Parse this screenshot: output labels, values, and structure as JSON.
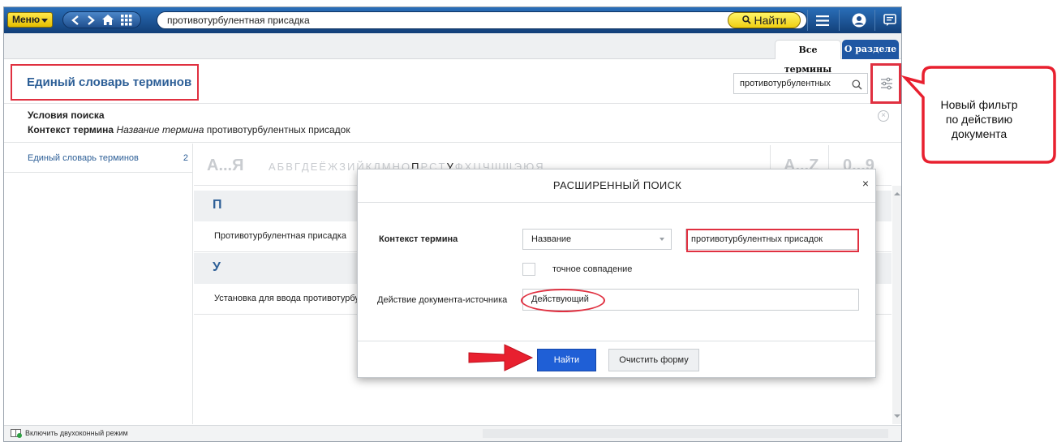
{
  "topbar": {
    "menu_label": "Меню",
    "search_value": "противотурбулентная присадка",
    "find_label": "Найти"
  },
  "tabs": [
    {
      "label": "Все термины",
      "active": true
    },
    {
      "label": "О разделе",
      "active": false
    }
  ],
  "header": {
    "title": "Единый словарь терминов",
    "search_value": "противотурбулентных"
  },
  "conditions": {
    "title": "Условия поиска",
    "field_label": "Контекст термина",
    "field_mode": "Название термина",
    "field_value": "противотурбулентных присадок"
  },
  "sidebar": {
    "items": [
      {
        "label": "Единый словарь терминов",
        "count": "2"
      }
    ]
  },
  "alphabet": {
    "cyrillic_range": "А...Я",
    "latin_range": "А...Z",
    "digits_range": "0...9",
    "letters": [
      "А",
      "Б",
      "В",
      "Г",
      "Д",
      "Е",
      "Ё",
      "Ж",
      "З",
      "И",
      "Й",
      "К",
      "Л",
      "М",
      "Н",
      "О",
      "П",
      "Р",
      "С",
      "Т",
      "У",
      "Ф",
      "Х",
      "Ц",
      "Ч",
      "Ш",
      "Щ",
      "Э",
      "Ю",
      "Я"
    ],
    "active_letters": [
      "П",
      "У"
    ]
  },
  "groups": [
    {
      "letter": "П",
      "term": "Противотурбулентная присадка"
    },
    {
      "letter": "У",
      "term": "Установка для ввода противотурбулентной присадки"
    }
  ],
  "dialog": {
    "title": "РАСШИРЕННЫЙ ПОИСК",
    "close": "×",
    "context_label": "Контекст термина",
    "context_mode": "Название",
    "context_value": "противотурбулентных присадок",
    "exact_match_label": "точное совпадение",
    "action_label": "Действие документа-источника",
    "action_value": "Действующий",
    "find_button": "Найти",
    "clear_button": "Очистить форму"
  },
  "status": {
    "two_window_label": "Включить двухоконный режим"
  },
  "callout": {
    "lines": [
      "Новый фильтр",
      "по действию",
      "документа"
    ]
  },
  "colors": {
    "accent_blue": "#1f5fd6",
    "title_blue": "#2d5f97",
    "highlight_red": "#e03040",
    "menu_yellow": "#f0cf12"
  }
}
